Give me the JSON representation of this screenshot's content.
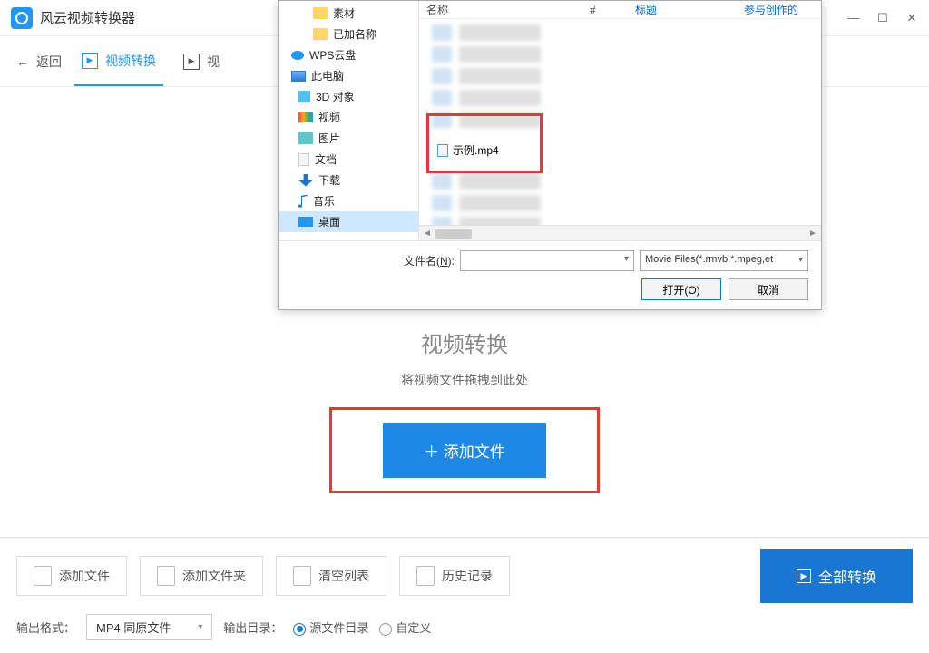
{
  "app": {
    "title": "风云视频转换器"
  },
  "window": {
    "min": "—",
    "max": "☐",
    "close": "✕"
  },
  "nav": {
    "back": "返回",
    "tab_convert": "视频转换",
    "tab_other": "视"
  },
  "center": {
    "title": "视频转换",
    "subtitle": "将视频文件拖拽到此处",
    "add_btn": "＋ 添加文件"
  },
  "toolbar": {
    "add_file": "添加文件",
    "add_folder": "添加文件夹",
    "clear": "清空列表",
    "history": "历史记录",
    "convert_all": "全部转换"
  },
  "opts": {
    "output_format_label": "输出格式：",
    "output_format_value": "MP4 同原文件",
    "output_dir_label": "输出目录：",
    "radio_source": "源文件目录",
    "radio_custom": "自定义"
  },
  "dialog": {
    "nav_items": {
      "sucai": "素材",
      "added": "已加名称",
      "wps": "WPS云盘",
      "thispc": "此电脑",
      "obj3d": "3D 对象",
      "video": "视频",
      "images": "图片",
      "docs": "文档",
      "downloads": "下载",
      "music": "音乐",
      "desktop": "桌面"
    },
    "headers": {
      "name": "名称",
      "num": "#",
      "title": "标题",
      "artist": "参与创作的"
    },
    "example_file": "示例.mp4",
    "filename_label_pre": "文件名(",
    "filename_label_u": "N",
    "filename_label_post": "):",
    "filter": "Movie Files(*.rmvb,*.mpeg,et",
    "open": "打开(O)",
    "cancel": "取消"
  }
}
